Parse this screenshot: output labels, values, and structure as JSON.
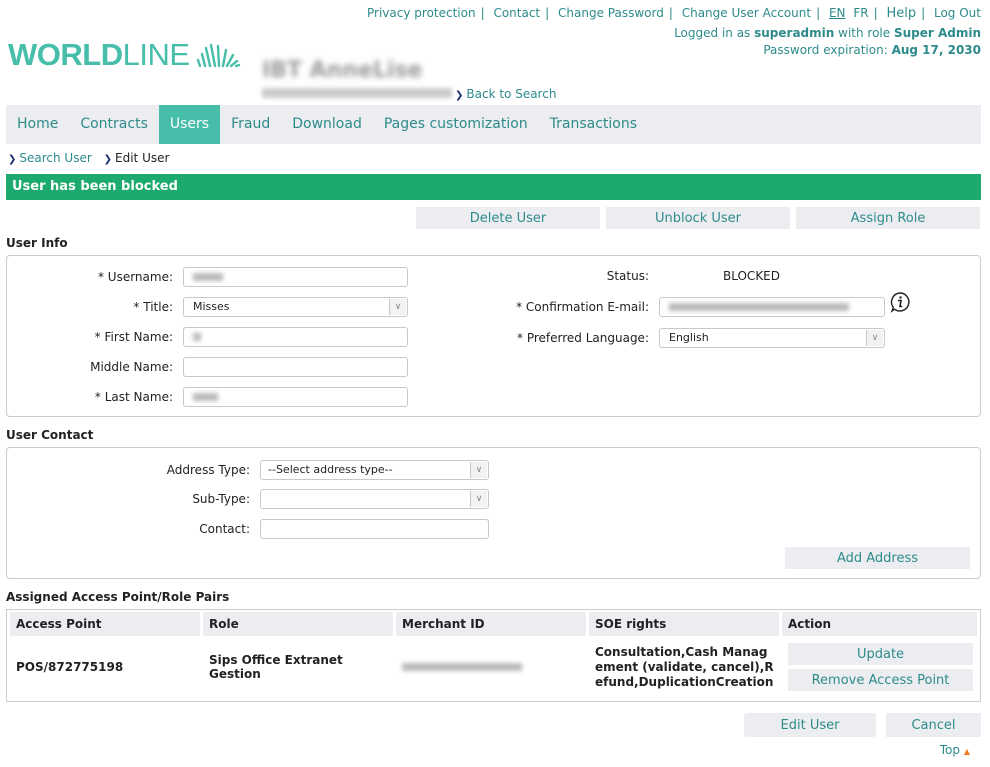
{
  "header": {
    "top_links": [
      "Privacy protection",
      "Contact",
      "Change Password",
      "Change User Account"
    ],
    "lang_en": "EN",
    "lang_fr": "FR",
    "help": "Help",
    "logout": "Log Out",
    "logged_in_prefix": "Logged in as ",
    "username": "superadmin",
    "role_prefix": " with role ",
    "role": "Super Admin",
    "password_expiration_label": "Password expiration: ",
    "password_expiration": "Aug 17, 2030",
    "logo_bold": "WORLD",
    "logo_light": "LINE",
    "merchant_name": "IBT AnneLise",
    "back_to_search": "Back to Search"
  },
  "nav": {
    "items": [
      {
        "label": "Home",
        "active": false
      },
      {
        "label": "Contracts",
        "active": false
      },
      {
        "label": "Users",
        "active": true
      },
      {
        "label": "Fraud",
        "active": false
      },
      {
        "label": "Download",
        "active": false
      },
      {
        "label": "Pages customization",
        "active": false
      },
      {
        "label": "Transactions",
        "active": false
      }
    ]
  },
  "breadcrumb": {
    "items": [
      "Search User",
      "Edit User"
    ]
  },
  "alert": {
    "message": "User has been blocked",
    "color": "#1daa6e"
  },
  "actions": {
    "delete_user": "Delete User",
    "unblock_user": "Unblock User",
    "assign_role": "Assign Role"
  },
  "user_info": {
    "title": "User Info",
    "username_label": "* Username:",
    "title_label": "* Title:",
    "title_value": "Misses",
    "first_name_label": "* First Name:",
    "middle_name_label": "Middle Name:",
    "middle_name_value": "",
    "last_name_label": "* Last Name:",
    "status_label": "Status:",
    "status_value": "BLOCKED",
    "confirmation_email_label": "* Confirmation E-mail:",
    "preferred_language_label": "* Preferred Language:",
    "preferred_language_value": "English"
  },
  "user_contact": {
    "title": "User Contact",
    "address_type_label": "Address Type:",
    "address_type_value": "--Select address type--",
    "sub_type_label": "Sub-Type:",
    "sub_type_value": "",
    "contact_label": "Contact:",
    "contact_value": "",
    "add_address": "Add Address"
  },
  "access_points": {
    "title": "Assigned Access Point/Role Pairs",
    "columns": [
      "Access Point",
      "Role",
      "Merchant ID",
      "SOE rights",
      "Action"
    ],
    "rows": [
      {
        "access_point": "POS/872775198",
        "role": "Sips Office Extranet Gestion",
        "soe_rights": "Consultation,Cash Management (validate, cancel),Refund,DuplicationCreation",
        "update": "Update",
        "remove": "Remove Access Point"
      }
    ]
  },
  "footer": {
    "edit_user": "Edit User",
    "cancel": "Cancel",
    "top": "Top"
  },
  "colors": {
    "brand": "#46beaa",
    "link": "#2e8b8b",
    "top_arrow": "#f07820"
  }
}
